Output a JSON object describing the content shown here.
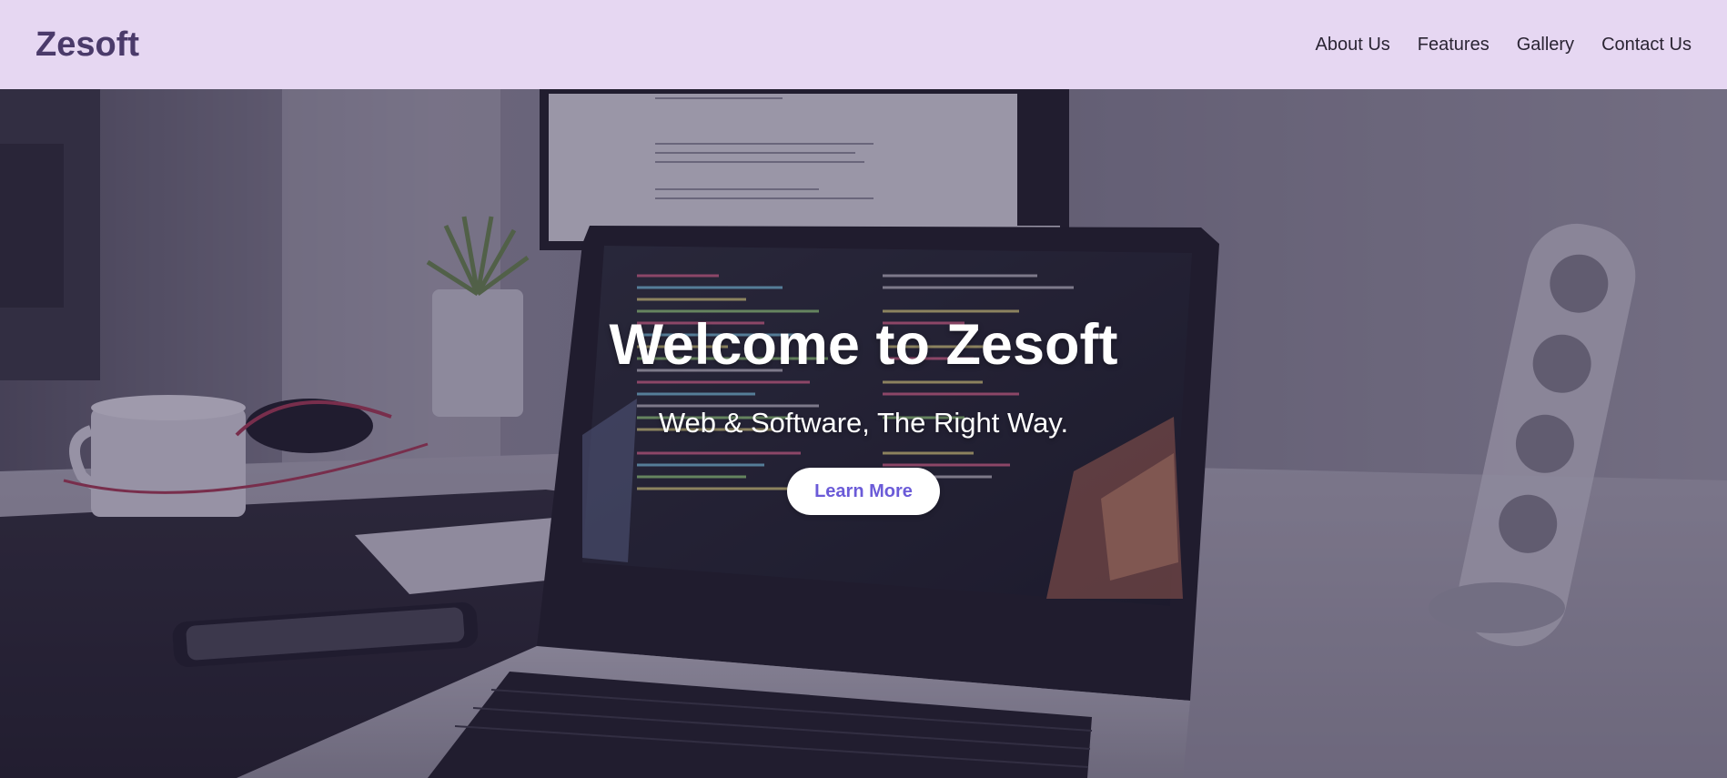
{
  "brand": {
    "name": "Zesoft"
  },
  "nav": {
    "items": [
      {
        "label": "About Us"
      },
      {
        "label": "Features"
      },
      {
        "label": "Gallery"
      },
      {
        "label": "Contact Us"
      }
    ]
  },
  "hero": {
    "title": "Welcome to Zesoft",
    "subtitle": "Web & Software, The Right Way.",
    "cta_label": "Learn More"
  },
  "colors": {
    "navbar_bg": "#e6d7f2",
    "brand_text": "#4a3a6a",
    "nav_text": "#2a2433",
    "cta_text": "#6b5bd8",
    "hero_overlay": "rgba(40, 30, 70, 0.42)"
  }
}
